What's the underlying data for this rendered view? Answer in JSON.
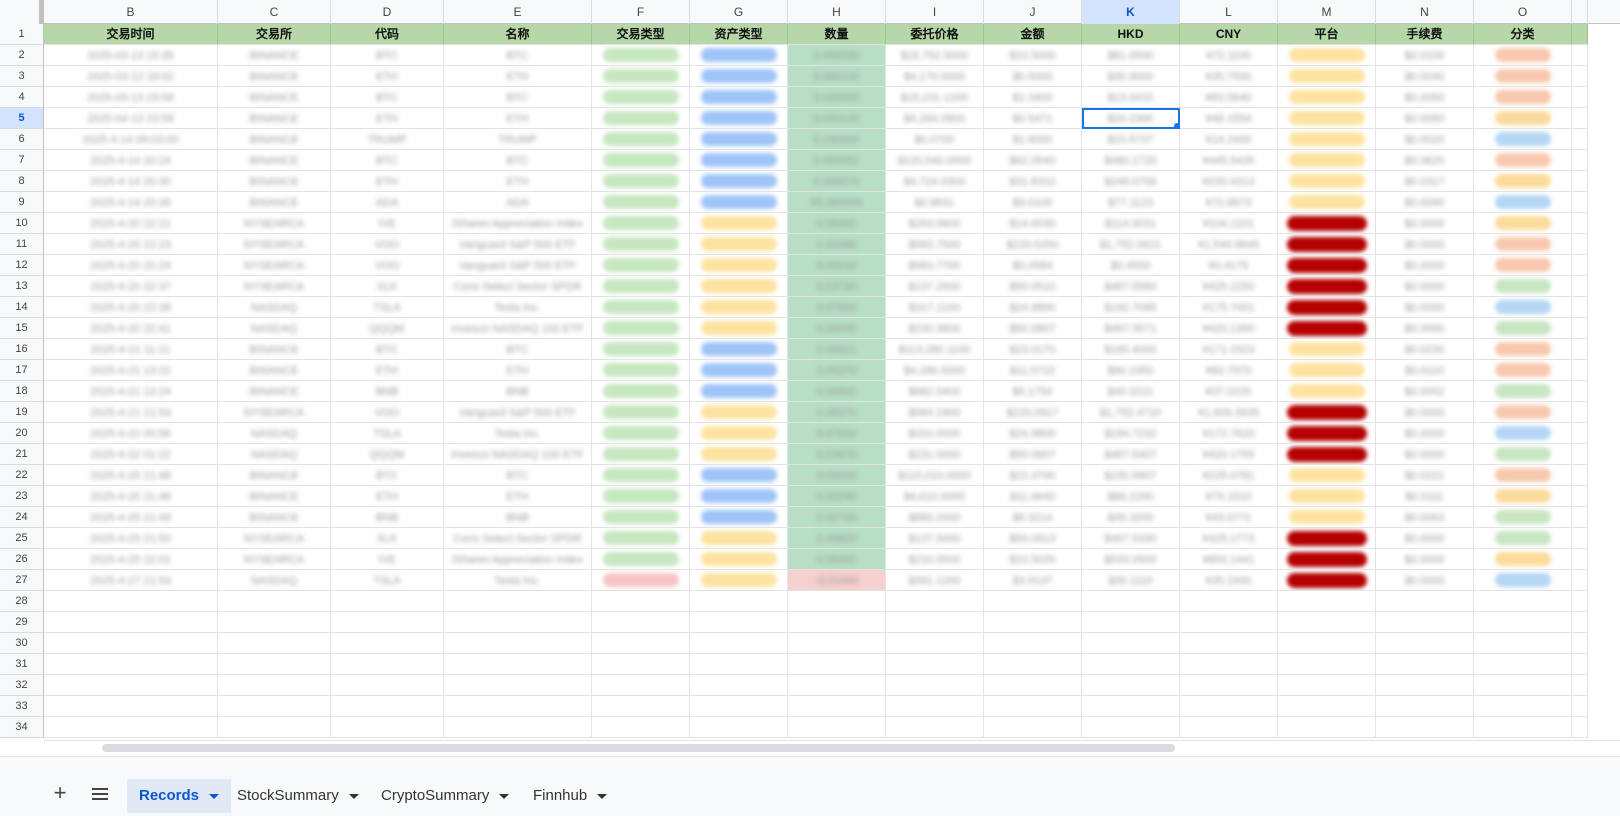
{
  "columns": [
    {
      "letter": "B",
      "header": "交易时间"
    },
    {
      "letter": "C",
      "header": "交易所"
    },
    {
      "letter": "D",
      "header": "代码"
    },
    {
      "letter": "E",
      "header": "名称"
    },
    {
      "letter": "F",
      "header": "交易类型"
    },
    {
      "letter": "G",
      "header": "资产类型"
    },
    {
      "letter": "H",
      "header": "数量"
    },
    {
      "letter": "I",
      "header": "委托价格"
    },
    {
      "letter": "J",
      "header": "金额"
    },
    {
      "letter": "K",
      "header": "HKD"
    },
    {
      "letter": "L",
      "header": "CNY"
    },
    {
      "letter": "M",
      "header": "平台"
    },
    {
      "letter": "N",
      "header": "手续费"
    },
    {
      "letter": "O",
      "header": "分类"
    }
  ],
  "selected": {
    "column": "K",
    "row": "5"
  },
  "filter_column": "M",
  "row_numbers": [
    "1",
    "2",
    "3",
    "4",
    "5",
    "6",
    "7",
    "8",
    "9",
    "10",
    "11",
    "12",
    "13",
    "14",
    "15",
    "16",
    "17",
    "18",
    "19",
    "20",
    "21",
    "22",
    "23",
    "24",
    "25",
    "26",
    "27",
    "28",
    "29",
    "30",
    "31",
    "32",
    "33",
    "34"
  ],
  "rows": [
    {
      "time": "2025-03-13 15:35",
      "exch": "BINANCE",
      "code": "BTC",
      "name": "BTC",
      "type": "green",
      "asset": "blue",
      "qty": "0.000030",
      "price": "$15,752.0000",
      "amount": "$10.5000",
      "hkd": "$81.0500",
      "cny": "¥72.1100",
      "platform": "yellow",
      "fee": "$0.0100",
      "cat": "lightorange",
      "qtyneg": false
    },
    {
      "time": "2025-03-13 18:02",
      "exch": "BINANCE",
      "code": "ETH",
      "name": "ETH",
      "type": "green",
      "asset": "blue",
      "qty": "0.000120",
      "price": "$4,170.0000",
      "amount": "$0.5000",
      "hkd": "$30.9000",
      "cny": "¥35.7500",
      "platform": "yellow",
      "fee": "$0.0040",
      "cat": "lightorange",
      "qtyneg": false
    },
    {
      "time": "2025-03-13 23:58",
      "exch": "BINANCE",
      "code": "BTC",
      "name": "BTC",
      "type": "green",
      "asset": "blue",
      "qty": "0.000000",
      "price": "$15,231.1200",
      "amount": "$1.3400",
      "hkd": "$13.0410",
      "cny": "¥83.5640",
      "platform": "yellow",
      "fee": "$0.0050",
      "cat": "lightorange",
      "qtyneg": false
    },
    {
      "time": "2025-04-13 23:58",
      "exch": "BINANCE",
      "code": "ETH",
      "name": "ETH",
      "type": "green",
      "asset": "blue",
      "qty": "0.000120",
      "price": "$4,284.0900",
      "amount": "$0.5471",
      "hkd": "$33.2300",
      "cny": "¥46.1554",
      "platform": "yellow",
      "fee": "$0.0050",
      "cat": "lightyellow",
      "qtyneg": false
    },
    {
      "time": "2025-4-14 09:03:00",
      "exch": "BINANCE",
      "code": "TRUMP",
      "name": "TRUMP",
      "type": "green",
      "asset": "blue",
      "qty": "0.190000",
      "price": "$0.0700",
      "amount": "$1.9000",
      "hkd": "$15.5737",
      "cny": "¥14.2400",
      "platform": "yellow",
      "fee": "$0.0020",
      "cat": "lightblue",
      "qtyneg": false
    },
    {
      "time": "2025-4-14 20:24",
      "exch": "BINANCE",
      "code": "BTC",
      "name": "BTC",
      "type": "green",
      "asset": "blue",
      "qty": "0.000052",
      "price": "$120,540.0000",
      "amount": "$62.0540",
      "hkd": "$480.1720",
      "cny": "¥445.5435",
      "platform": "yellow",
      "fee": "$0.0620",
      "cat": "lightorange",
      "qtyneg": false
    },
    {
      "time": "2025-4-14 20:30",
      "exch": "BINANCE",
      "code": "ETH",
      "name": "ETH",
      "type": "green",
      "asset": "blue",
      "qty": "0.000070",
      "price": "$4,724.0300",
      "amount": "$31.8310",
      "hkd": "$248.0756",
      "cny": "¥230.4313",
      "platform": "yellow",
      "fee": "$0.0317",
      "cat": "lightyellow",
      "qtyneg": false
    },
    {
      "time": "2025-4-14 20:36",
      "exch": "BINANCE",
      "code": "ADA",
      "name": "ADA",
      "type": "green",
      "asset": "blue",
      "qty": "55.380000",
      "price": "$0.9831",
      "amount": "$9.0100",
      "hkd": "$77.1123",
      "cny": "¥72.8873",
      "platform": "yellow",
      "fee": "$0.0090",
      "cat": "lightblue",
      "qtyneg": false
    },
    {
      "time": "2025-4-20 22:21",
      "exch": "NYSEARCA",
      "code": "IVE",
      "name": "iShares Appreciation Index",
      "type": "green",
      "asset": "yellow",
      "qty": "0.05000",
      "price": "$293.0600",
      "amount": "$14.6530",
      "hkd": "$114.0031",
      "cny": "¥104.1101",
      "platform": "darkred",
      "fee": "$0.0000",
      "cat": "lightyellow",
      "qtyneg": false
    },
    {
      "time": "2025-4-20 22:23",
      "exch": "NYSEARCA",
      "code": "VOO",
      "name": "Vanguard S&P 500 ETF",
      "type": "green",
      "asset": "yellow",
      "qty": "0.33380",
      "price": "$583.7500",
      "amount": "$220.5250",
      "hkd": "$1,752.0621",
      "cny": "¥1,544.9645",
      "platform": "darkred",
      "fee": "$0.0000",
      "cat": "lightorange",
      "qtyneg": false
    },
    {
      "time": "2025-4-20 22:24",
      "exch": "NYSEARCA",
      "code": "VOO",
      "name": "Vanguard S&P 500 ETF",
      "type": "green",
      "asset": "yellow",
      "qty": "0.00010",
      "price": "$583.7700",
      "amount": "$0.0584",
      "hkd": "$0.4550",
      "cny": "¥0.4175",
      "platform": "darkred",
      "fee": "$0.0000",
      "cat": "lightorange",
      "qtyneg": false
    },
    {
      "time": "2025-4-20 22:37",
      "exch": "NYSEARCA",
      "code": "XLK",
      "name": "Cons Select Sector SPDR",
      "type": "green",
      "asset": "yellow",
      "qty": "0.23730",
      "price": "$137.2500",
      "amount": "$50.0510",
      "hkd": "$467.5560",
      "cny": "¥425.2250",
      "platform": "darkred",
      "fee": "$0.0000",
      "cat": "lightgreen",
      "qtyneg": false
    },
    {
      "time": "2025-4-20 22:38",
      "exch": "NASDAQ",
      "code": "TSLA",
      "name": "Tesla Inc.",
      "type": "green",
      "asset": "yellow",
      "qty": "0.07900",
      "price": "$317.1100",
      "amount": "$24.9800",
      "hkd": "$192.7095",
      "cny": "¥175.7001",
      "platform": "darkred",
      "fee": "$0.0000",
      "cat": "lightblue",
      "qtyneg": false
    },
    {
      "time": "2025-4-20 22:41",
      "exch": "NASDAQ",
      "code": "QQQM",
      "name": "Invesco NASDAQ 100 ETF",
      "type": "green",
      "asset": "yellow",
      "qty": "0.29000",
      "price": "$230.3600",
      "amount": "$50.0807",
      "hkd": "$467.5571",
      "cny": "¥420.1380",
      "platform": "darkred",
      "fee": "$0.0000",
      "cat": "lightgreen",
      "qtyneg": false
    },
    {
      "time": "2025-4-21 11:21",
      "exch": "BINANCE",
      "code": "BTC",
      "name": "BTC",
      "type": "green",
      "asset": "blue",
      "qty": "0.00021",
      "price": "$113,280.1100",
      "amount": "$23.0170",
      "hkd": "$185.4000",
      "cny": "¥171.1523",
      "platform": "yellow",
      "fee": "$0.0230",
      "cat": "lightorange",
      "qtyneg": false
    },
    {
      "time": "2025-4-21 13:22",
      "exch": "BINANCE",
      "code": "ETH",
      "name": "ETH",
      "type": "green",
      "asset": "blue",
      "qty": "0.00270",
      "price": "$4,286.0000",
      "amount": "$11.5722",
      "hkd": "$90.1950",
      "cny": "¥82.7970",
      "platform": "yellow",
      "fee": "$0.0110",
      "cat": "lightorange",
      "qtyneg": false
    },
    {
      "time": "2025-4-21 13:24",
      "exch": "BINANCE",
      "code": "BNB",
      "name": "BNB",
      "type": "green",
      "asset": "blue",
      "qty": "0.00600",
      "price": "$882.0400",
      "amount": "$5.1750",
      "hkd": "$40.3221",
      "cny": "¥37.0220",
      "platform": "yellow",
      "fee": "$0.0052",
      "cat": "lightgreen",
      "qtyneg": false
    },
    {
      "time": "2025-4-21 21:53",
      "exch": "NYSEARCA",
      "code": "VOO",
      "name": "Vanguard S&P 500 ETF",
      "type": "green",
      "asset": "yellow",
      "qty": "0.35370",
      "price": "$584.1900",
      "amount": "$220.0917",
      "hkd": "$1,752.4710",
      "cny": "¥1,609.3935",
      "platform": "darkred",
      "fee": "$0.0000",
      "cat": "lightorange",
      "qtyneg": false
    },
    {
      "time": "2025-4-22 00:56",
      "exch": "NASDAQ",
      "code": "TSLA",
      "name": "Tesla Inc.",
      "type": "green",
      "asset": "yellow",
      "qty": "0.07920",
      "price": "$310.0000",
      "amount": "$24.9800",
      "hkd": "$194.7232",
      "cny": "¥172.7620",
      "platform": "darkred",
      "fee": "$0.0000",
      "cat": "lightblue",
      "qtyneg": false
    },
    {
      "time": "2025-4-22 01:22",
      "exch": "NASDAQ",
      "code": "QQQM",
      "name": "Invesco NASDAQ 100 ETF",
      "type": "green",
      "asset": "yellow",
      "qty": "0.23970",
      "price": "$231.0000",
      "amount": "$50.0907",
      "hkd": "$467.5407",
      "cny": "¥420.1755",
      "platform": "darkred",
      "fee": "$0.0000",
      "cat": "lightgreen",
      "qtyneg": false
    },
    {
      "time": "2025-4-25 21:48",
      "exch": "BINANCE",
      "code": "BTC",
      "name": "BTC",
      "type": "green",
      "asset": "blue",
      "qty": "0.00020",
      "price": "$115,010.0000",
      "amount": "$22.3700",
      "hkd": "$230.9907",
      "cny": "¥225.0781",
      "platform": "yellow",
      "fee": "$0.0221",
      "cat": "lightorange",
      "qtyneg": false
    },
    {
      "time": "2025-4-25 21:48",
      "exch": "BINANCE",
      "code": "ETH",
      "name": "ETH",
      "type": "green",
      "asset": "blue",
      "qty": "0.00240",
      "price": "$4,610.0000",
      "amount": "$11.0640",
      "hkd": "$86.2200",
      "cny": "¥79.1510",
      "platform": "yellow",
      "fee": "$0.0111",
      "cat": "lightyellow",
      "qtyneg": false
    },
    {
      "time": "2025-4-25 21:49",
      "exch": "BINANCE",
      "code": "BNB",
      "name": "BNB",
      "type": "green",
      "asset": "blue",
      "qty": "0.00700",
      "price": "$880.2000",
      "amount": "$6.3214",
      "hkd": "$49.3200",
      "cny": "¥43.0771",
      "platform": "yellow",
      "fee": "$0.0063",
      "cat": "lightgreen",
      "qtyneg": false
    },
    {
      "time": "2025-4-25 21:50",
      "exch": "NYSEARCA",
      "code": "XLK",
      "name": "Cons Select Sector SPDR",
      "type": "green",
      "asset": "yellow",
      "qty": "0.40820",
      "price": "$137.5000",
      "amount": "$50.0913",
      "hkd": "$467.5330",
      "cny": "¥425.1773",
      "platform": "darkred",
      "fee": "$0.0000",
      "cat": "lightgreen",
      "qtyneg": false
    },
    {
      "time": "2025-4-25 22:01",
      "exch": "NYSEARCA",
      "code": "IVE",
      "name": "iShares Appreciation Index",
      "type": "green",
      "asset": "yellow",
      "qty": "0.05000",
      "price": "$210.0500",
      "amount": "$10.5025",
      "hkd": "$533.0500",
      "cny": "¥850.1441",
      "platform": "darkred",
      "fee": "$0.0000",
      "cat": "lightyellow",
      "qtyneg": false
    },
    {
      "time": "2025-4-27 21:53",
      "exch": "NASDAQ",
      "code": "TSLA",
      "name": "Tesla Inc.",
      "type": "red",
      "asset": "yellow",
      "qty": "-0.01000",
      "price": "$391.1200",
      "amount": "$3.9137",
      "hkd": "$30.1110",
      "cny": "¥35.1500",
      "platform": "darkred",
      "fee": "$0.0000",
      "cat": "lightblue",
      "qtyneg": true
    }
  ],
  "tabbar": {
    "add_label": "+",
    "tabs": [
      {
        "label": "Records",
        "active": true
      },
      {
        "label": "StockSummary",
        "active": false
      },
      {
        "label": "CryptoSummary",
        "active": false
      },
      {
        "label": "Finnhub",
        "active": false
      }
    ]
  },
  "colors": {
    "header_fill": "#b6d7a8",
    "qty_fill": "#b7dfc6",
    "selection": "#1a73e8",
    "active_tab": "#0b57d0"
  }
}
